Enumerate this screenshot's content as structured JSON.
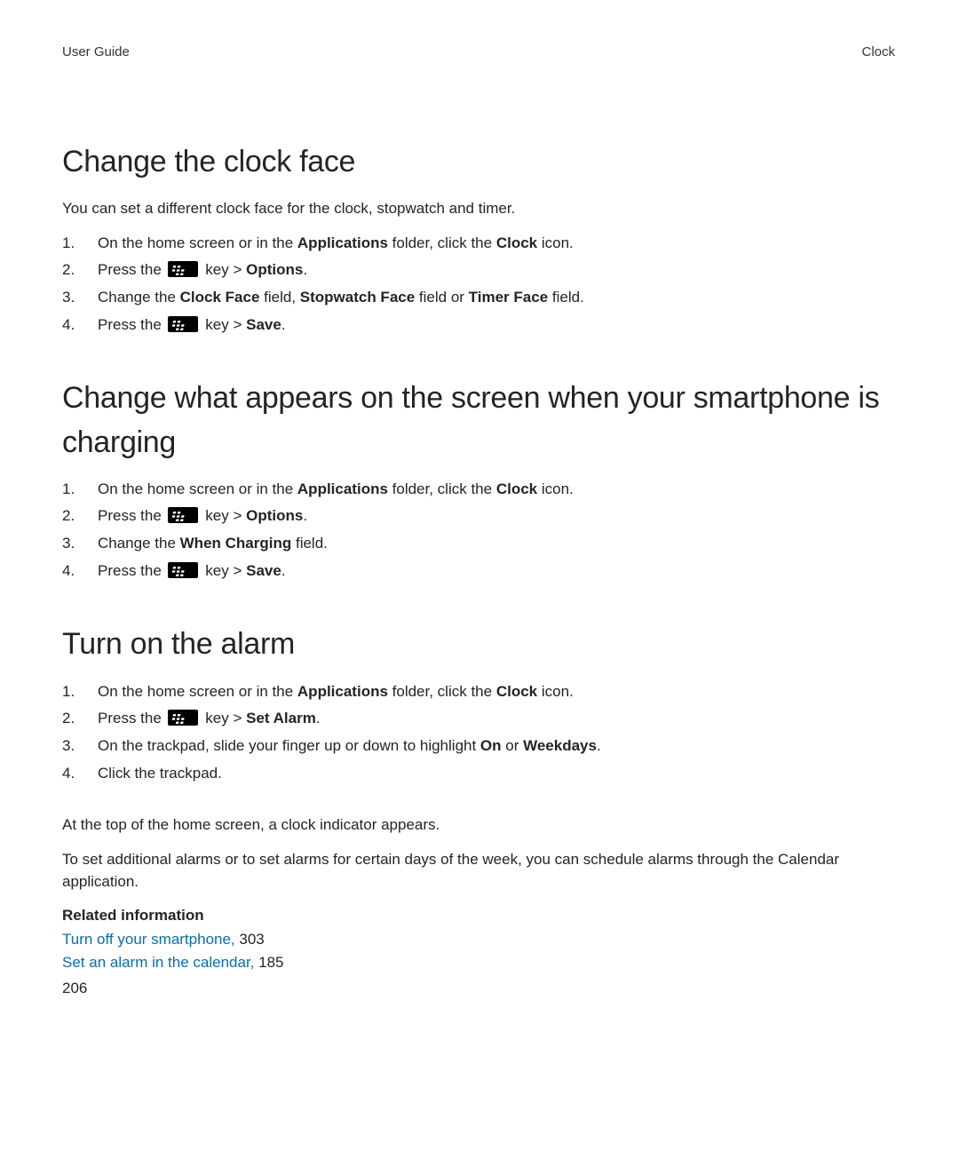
{
  "header": {
    "left": "User Guide",
    "right": "Clock"
  },
  "page_number": "206",
  "sections": [
    {
      "heading": "Change the clock face",
      "intro": "You can set a different clock face for the clock, stopwatch and timer.",
      "steps": [
        {
          "segments": [
            {
              "t": "text",
              "v": "On the home screen or in the "
            },
            {
              "t": "bold",
              "v": "Applications"
            },
            {
              "t": "text",
              "v": " folder, click the "
            },
            {
              "t": "bold",
              "v": "Clock"
            },
            {
              "t": "text",
              "v": " icon."
            }
          ]
        },
        {
          "segments": [
            {
              "t": "text",
              "v": "Press the "
            },
            {
              "t": "icon",
              "v": "bb-key"
            },
            {
              "t": "text",
              "v": " key > "
            },
            {
              "t": "bold",
              "v": "Options"
            },
            {
              "t": "text",
              "v": "."
            }
          ]
        },
        {
          "segments": [
            {
              "t": "text",
              "v": "Change the "
            },
            {
              "t": "bold",
              "v": "Clock Face"
            },
            {
              "t": "text",
              "v": " field, "
            },
            {
              "t": "bold",
              "v": "Stopwatch Face"
            },
            {
              "t": "text",
              "v": " field or "
            },
            {
              "t": "bold",
              "v": "Timer Face"
            },
            {
              "t": "text",
              "v": " field."
            }
          ]
        },
        {
          "segments": [
            {
              "t": "text",
              "v": "Press the "
            },
            {
              "t": "icon",
              "v": "bb-key"
            },
            {
              "t": "text",
              "v": " key > "
            },
            {
              "t": "bold",
              "v": "Save"
            },
            {
              "t": "text",
              "v": "."
            }
          ]
        }
      ]
    },
    {
      "heading": "Change what appears on the screen when your smartphone is charging",
      "steps": [
        {
          "segments": [
            {
              "t": "text",
              "v": "On the home screen or in the "
            },
            {
              "t": "bold",
              "v": "Applications"
            },
            {
              "t": "text",
              "v": " folder, click the "
            },
            {
              "t": "bold",
              "v": "Clock"
            },
            {
              "t": "text",
              "v": " icon."
            }
          ]
        },
        {
          "segments": [
            {
              "t": "text",
              "v": "Press the "
            },
            {
              "t": "icon",
              "v": "bb-key"
            },
            {
              "t": "text",
              "v": " key > "
            },
            {
              "t": "bold",
              "v": "Options"
            },
            {
              "t": "text",
              "v": "."
            }
          ]
        },
        {
          "segments": [
            {
              "t": "text",
              "v": "Change the "
            },
            {
              "t": "bold",
              "v": "When Charging"
            },
            {
              "t": "text",
              "v": " field."
            }
          ]
        },
        {
          "segments": [
            {
              "t": "text",
              "v": "Press the "
            },
            {
              "t": "icon",
              "v": "bb-key"
            },
            {
              "t": "text",
              "v": " key > "
            },
            {
              "t": "bold",
              "v": "Save"
            },
            {
              "t": "text",
              "v": "."
            }
          ]
        }
      ]
    },
    {
      "heading": "Turn on the alarm",
      "steps": [
        {
          "segments": [
            {
              "t": "text",
              "v": "On the home screen or in the "
            },
            {
              "t": "bold",
              "v": "Applications"
            },
            {
              "t": "text",
              "v": " folder, click the "
            },
            {
              "t": "bold",
              "v": "Clock"
            },
            {
              "t": "text",
              "v": " icon."
            }
          ]
        },
        {
          "segments": [
            {
              "t": "text",
              "v": "Press the "
            },
            {
              "t": "icon",
              "v": "bb-key"
            },
            {
              "t": "text",
              "v": " key > "
            },
            {
              "t": "bold",
              "v": "Set Alarm"
            },
            {
              "t": "text",
              "v": "."
            }
          ]
        },
        {
          "segments": [
            {
              "t": "text",
              "v": "On the trackpad, slide your finger up or down to highlight "
            },
            {
              "t": "bold",
              "v": "On"
            },
            {
              "t": "text",
              "v": " or "
            },
            {
              "t": "bold",
              "v": "Weekdays"
            },
            {
              "t": "text",
              "v": "."
            }
          ]
        },
        {
          "segments": [
            {
              "t": "text",
              "v": "Click the trackpad."
            }
          ]
        }
      ],
      "after_paragraphs": [
        "At the top of the home screen, a clock indicator appears.",
        "To set additional alarms or to set alarms for certain days of the week, you can schedule alarms through the Calendar application."
      ],
      "related": {
        "heading": "Related information",
        "items": [
          {
            "link": "Turn off your smartphone,",
            "page": "303"
          },
          {
            "link": "Set an alarm in the calendar,",
            "page": "185"
          }
        ]
      }
    }
  ]
}
